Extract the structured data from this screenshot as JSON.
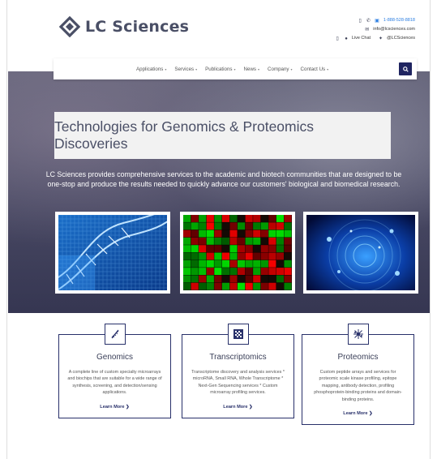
{
  "brand": {
    "logo_text": "LC Sciences"
  },
  "contact": {
    "phone": "1-888-528-8818",
    "email": "info@lcsciences.com",
    "live_chat": "Live Chat",
    "twitter": "@LCSciences"
  },
  "nav": {
    "items": [
      {
        "label": "Applications"
      },
      {
        "label": "Services"
      },
      {
        "label": "Publications"
      },
      {
        "label": "News"
      },
      {
        "label": "Company"
      },
      {
        "label": "Contact Us"
      }
    ],
    "search_icon": "search-icon"
  },
  "hero": {
    "title": "Technologies for Genomics & Proteomics Discoveries",
    "description": "LC Sciences provides comprehensive services to the academic and biotech communities that are designed to be one-stop and produce the results needed to quickly advance our customers' biological and biomedical research."
  },
  "cards": [
    {
      "title": "Genomics",
      "icon": "dna-icon",
      "text": "A complete line of custom specialty microarrays and biochips that are suitable for a wide range of synthesis, screening, and detection/sensing applications.",
      "link": "Learn More ❯"
    },
    {
      "title": "Transcriptomics",
      "icon": "microarray-icon",
      "text": "Transcriptome discovery and analysis services * microRNA, Small RNA, Whole Transcriptome * Next-Gen Sequencing services * Custom microarray profiling services.",
      "link": "Learn More ❯"
    },
    {
      "title": "Proteomics",
      "icon": "protein-icon",
      "text": "Custom peptide arrays and services for proteomic scale kinase profiling, epitope mapping, antibody detection, profiling phosphoprotein-binding proteins and domain-binding proteins.",
      "link": "Learn More ❯"
    }
  ],
  "colors": {
    "brand": "#4a4f66",
    "accent": "#1f2460",
    "link": "#2a7de1"
  }
}
